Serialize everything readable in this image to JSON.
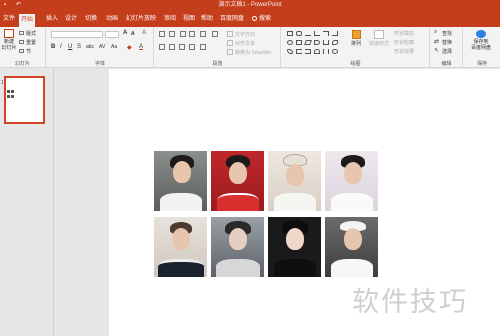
{
  "window": {
    "title": "演示文稿1 - PowerPoint",
    "qat_text": "↶"
  },
  "tabs": [
    {
      "label": "文件"
    },
    {
      "label": "开始"
    },
    {
      "label": "插入"
    },
    {
      "label": "设计"
    },
    {
      "label": "切换"
    },
    {
      "label": "动画"
    },
    {
      "label": "幻灯片放映"
    },
    {
      "label": "审阅"
    },
    {
      "label": "视图"
    },
    {
      "label": "帮助"
    },
    {
      "label": "百度网盘"
    },
    {
      "label": "搜索"
    }
  ],
  "ribbon": {
    "clipboard": {
      "group_label": "幻灯片",
      "new_slide": "新建\n幻灯片",
      "layout": "版式",
      "reset": "重置",
      "section": "节"
    },
    "font": {
      "group_label": "字体"
    },
    "paragraph": {
      "group_label": "段落",
      "text_direction": "文字方向",
      "align_text": "对齐文本",
      "convert_smartart": "转换为 SmartArt"
    },
    "drawing": {
      "group_label": "绘图",
      "arrange": "排列",
      "quick_styles": "快速样式",
      "shape_fill": "形状填充",
      "shape_outline": "形状轮廓",
      "shape_effects": "形状效果"
    },
    "editing": {
      "group_label": "编辑",
      "find": "查找",
      "replace": "替换",
      "select": "选择"
    },
    "save": {
      "group_label": "保存",
      "save_to_cloud": "保存到\n百度网盘"
    }
  },
  "slides_pane": {
    "slide_number": "1"
  },
  "watermark": "软件技巧",
  "colors": {
    "accent": "#c43e1c",
    "ribbon_bg": "#f3f3f3",
    "selected_border": "#d04525"
  }
}
